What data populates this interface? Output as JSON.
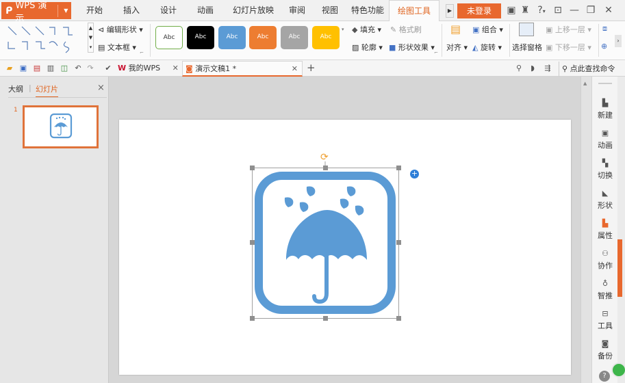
{
  "app": {
    "name": "WPS 演示"
  },
  "menu_tabs": [
    "开始",
    "插入",
    "设计",
    "动画",
    "幻灯片放映",
    "审阅",
    "视图",
    "特色功能",
    "绘图工具"
  ],
  "active_tab_index": 8,
  "login_label": "未登录",
  "window_controls": {
    "help": "?"
  },
  "ribbon": {
    "edit_shape": "编辑形状",
    "text_box": "文本框",
    "style_text": "Abc",
    "style_colors": [
      "#ffffff",
      "#000000",
      "#5b9bd5",
      "#ed7d31",
      "#a5a5a5",
      "#ffc000"
    ],
    "fill": "填充",
    "format_painter": "格式刷",
    "outline": "轮廓",
    "shape_effects": "形状效果",
    "align": "对齐",
    "group": "组合",
    "rotate": "旋转",
    "selection_pane": "选择窗格",
    "bring_forward": "上移一层",
    "send_backward": "下移一层"
  },
  "doc_tabs": [
    {
      "label": "我的WPS"
    },
    {
      "label": "演示文稿1 *"
    }
  ],
  "search_command": "点此查找命令",
  "left_pane": {
    "tab_outline": "大纲",
    "tab_slides": "幻灯片",
    "slide_number": "1"
  },
  "right_sidebar": [
    {
      "label": "新建",
      "icon": "new-doc-icon"
    },
    {
      "label": "动画",
      "icon": "animation-icon"
    },
    {
      "label": "切换",
      "icon": "transition-icon"
    },
    {
      "label": "形状",
      "icon": "shape-icon"
    },
    {
      "label": "属性",
      "icon": "property-icon"
    },
    {
      "label": "协作",
      "icon": "collaborate-icon"
    },
    {
      "label": "智推",
      "icon": "smart-icon"
    },
    {
      "label": "工具",
      "icon": "tools-icon"
    },
    {
      "label": "备份",
      "icon": "backup-icon"
    }
  ],
  "colors": {
    "accent": "#e8682e",
    "umbrella": "#5b9bd5"
  }
}
